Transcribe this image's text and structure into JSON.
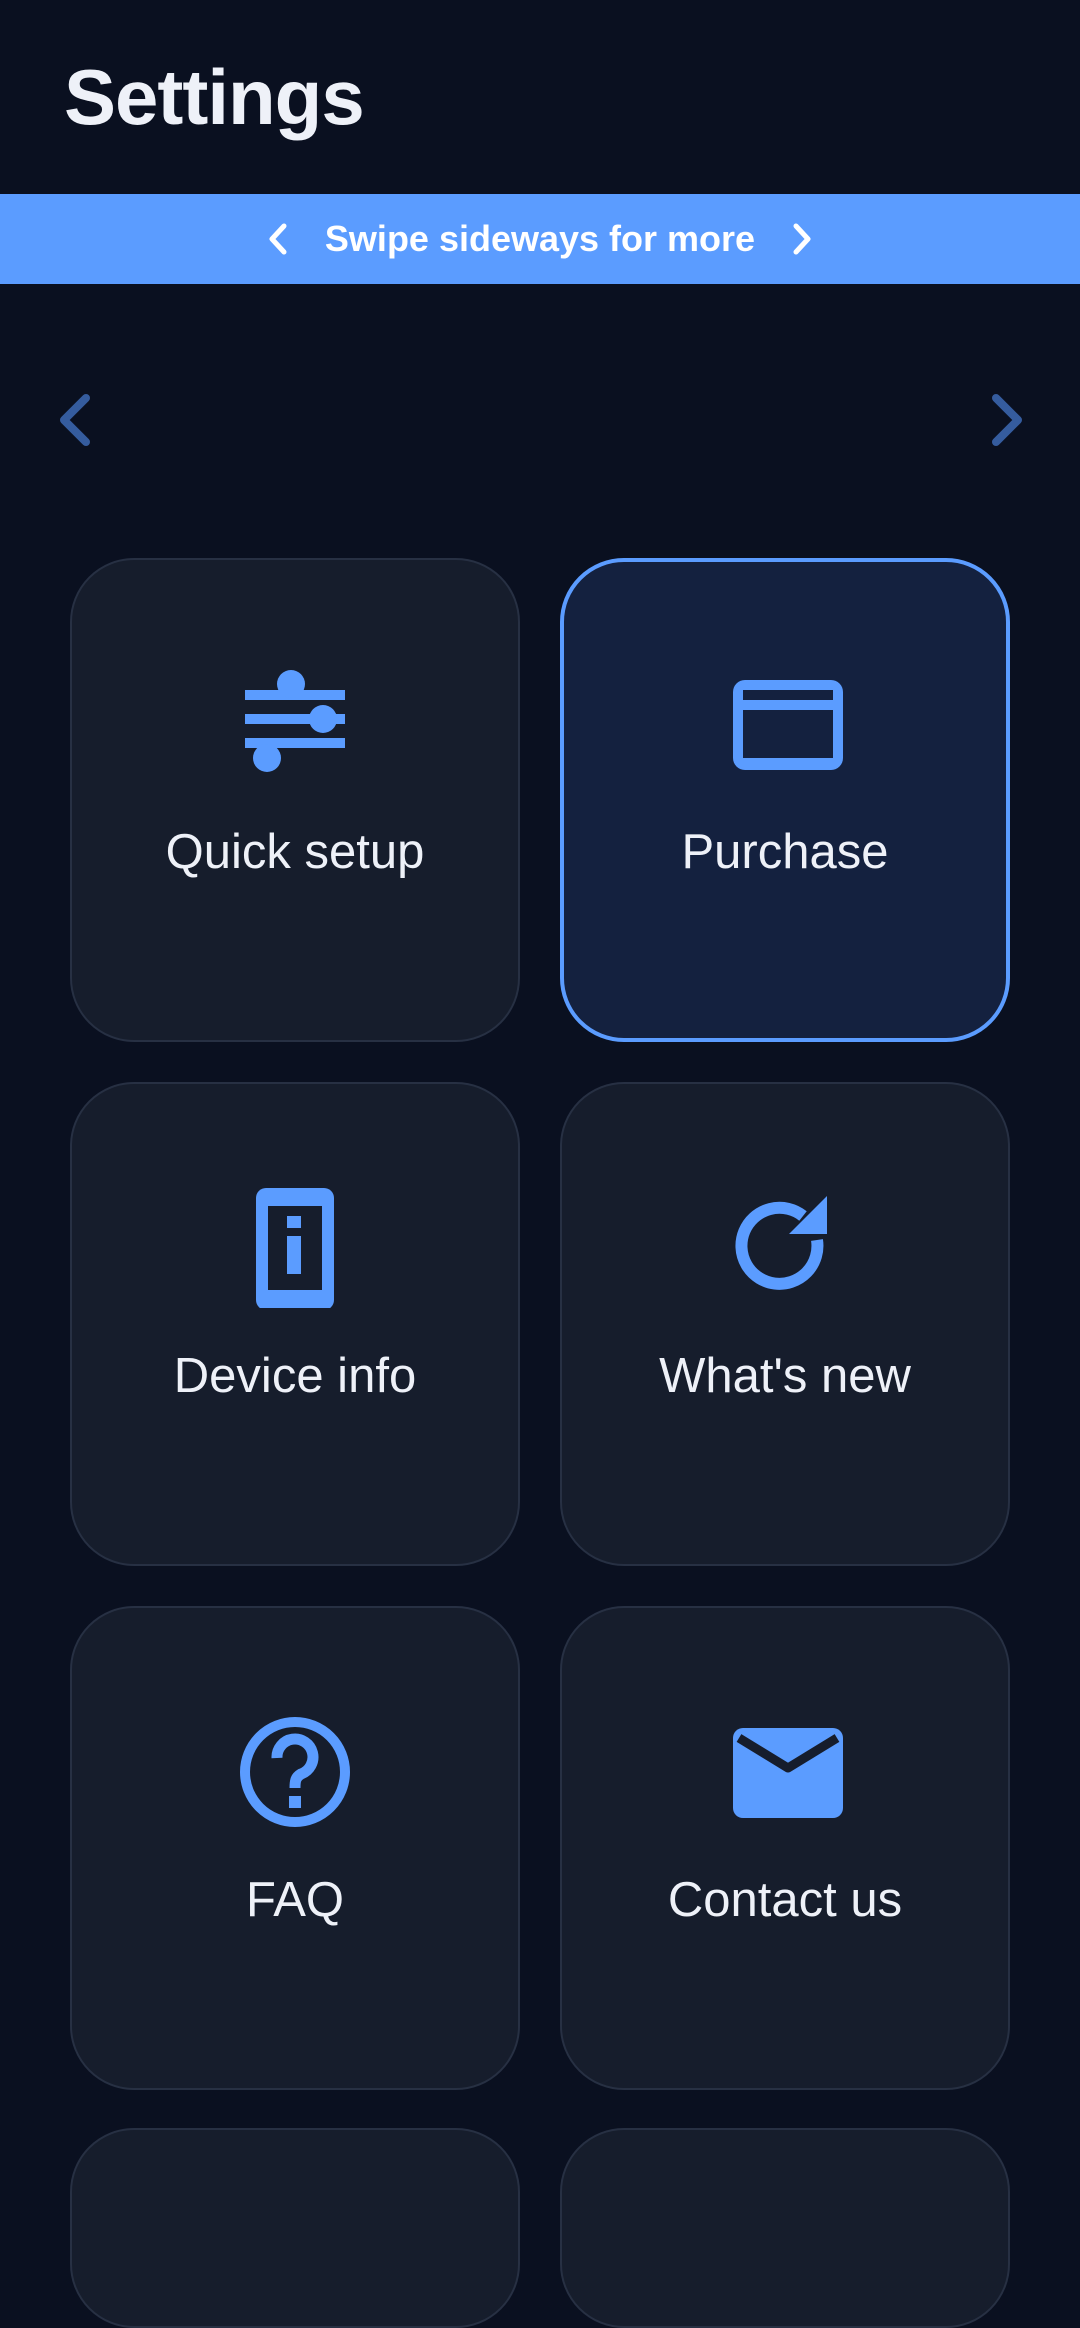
{
  "header": {
    "title": "Settings"
  },
  "banner": {
    "text": "Swipe sideways for more",
    "background": "#5b9cff"
  },
  "pager": {
    "prev_icon": "chevron-left-icon",
    "next_icon": "chevron-right-icon"
  },
  "tiles": [
    {
      "label": "Quick setup",
      "icon": "sliders-icon",
      "selected": false
    },
    {
      "label": "Purchase",
      "icon": "credit-card-icon",
      "selected": true
    },
    {
      "label": "Device info",
      "icon": "device-info-icon",
      "selected": false
    },
    {
      "label": "What's new",
      "icon": "refresh-icon",
      "selected": false
    },
    {
      "label": "FAQ",
      "icon": "help-circle-icon",
      "selected": false
    },
    {
      "label": "Contact us",
      "icon": "mail-icon",
      "selected": false
    }
  ],
  "colors": {
    "background": "#0a1020",
    "tile": "#161d2c",
    "tile_selected": "#14213f",
    "accent": "#5b9cff",
    "text": "#eef1f8"
  }
}
